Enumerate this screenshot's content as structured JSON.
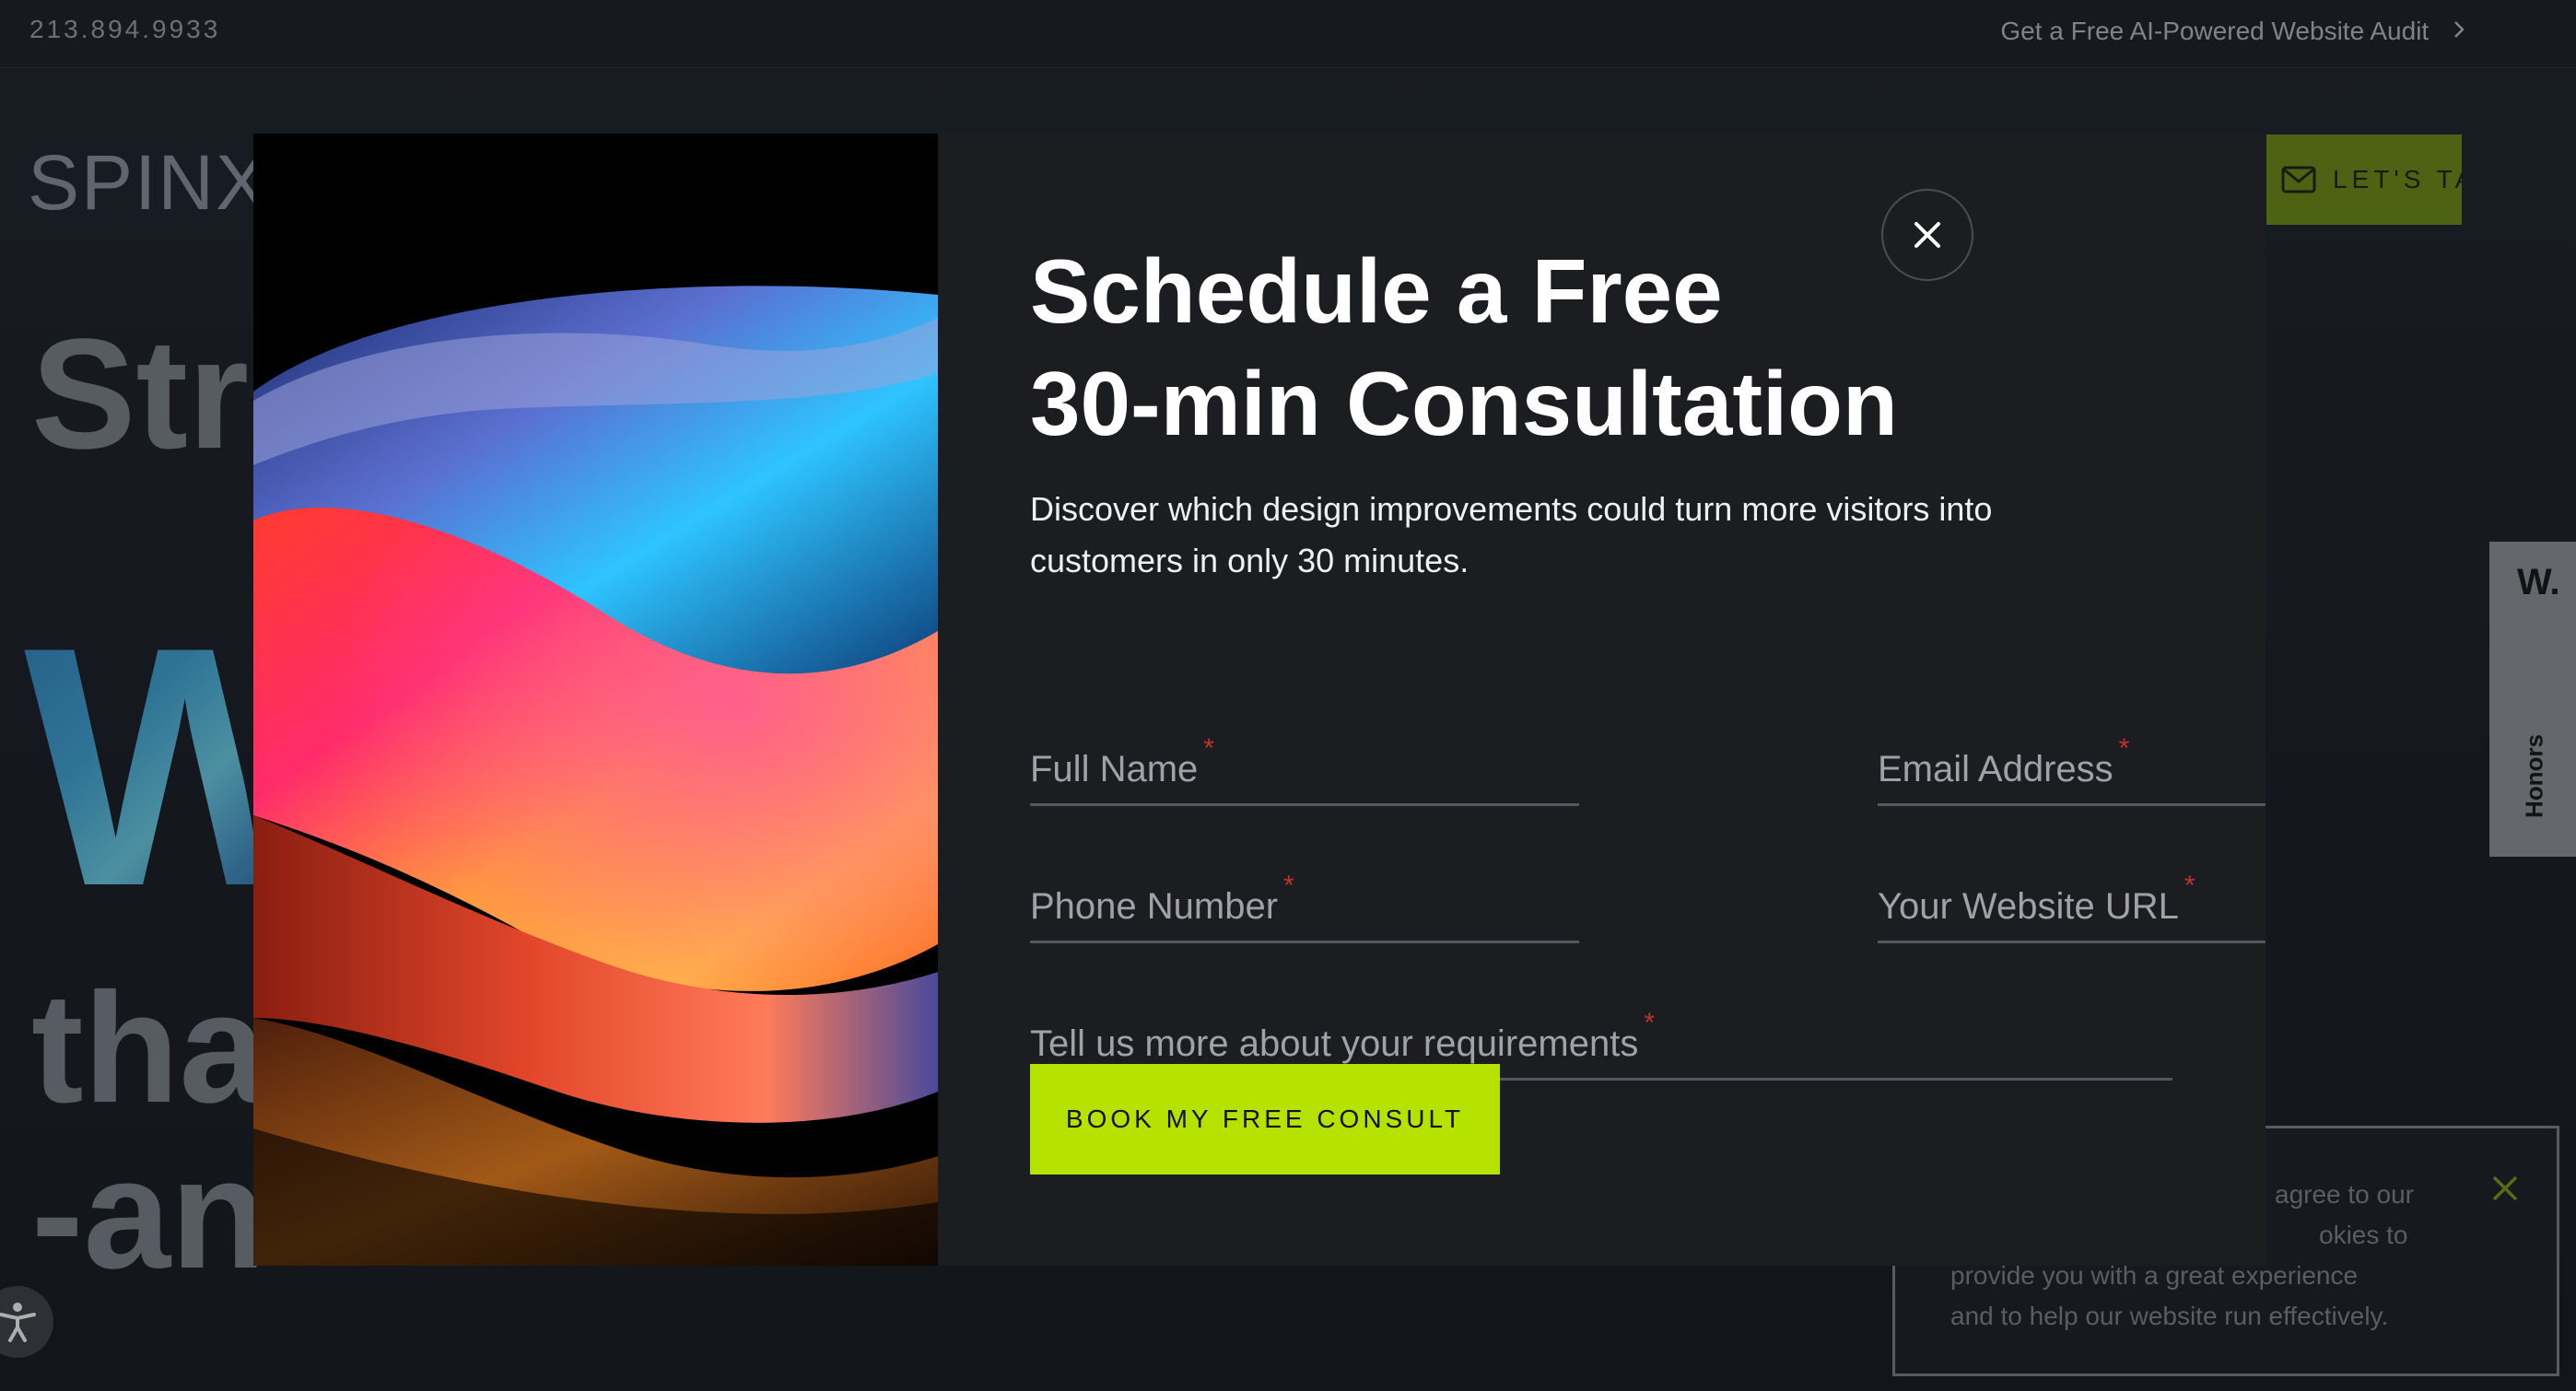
{
  "topbar": {
    "phone": "213.894.9933",
    "audit_link": "Get a Free AI-Powered Website Audit",
    "audit_chevron": "chevron-right-icon"
  },
  "background": {
    "logo": "SPINX",
    "hero_line1": "Stra",
    "hero_w": "W",
    "hero_line2": "tha",
    "hero_line3": "-an",
    "lets_talk": "LET'S TAL",
    "lets_talk_icon": "mail-icon",
    "honors_logo": "W.",
    "honors_label": "Honors",
    "accent": "#b6e200"
  },
  "cookie": {
    "text": "agree to our okies to provide you with a great experience and to help our website run effectively.",
    "line1": "agree to our",
    "line2": "okies to",
    "line3": "provide you with a great experience",
    "line4": "and to help our website run effectively."
  },
  "modal": {
    "title_line1": "Schedule a Free",
    "title_line2": "30-min Consultation",
    "description_line1": "Discover which design improvements could turn more visitors into",
    "description_line2": "customers in only 30 minutes.",
    "fields": {
      "full_name": "Full Name",
      "email": "Email Address",
      "phone": "Phone Number",
      "website": "Your Website URL",
      "requirements": "Tell us more about your requirements"
    },
    "required_marker": "*",
    "submit_label": "BOOK MY FREE CONSULT",
    "close_icon": "close-icon"
  }
}
